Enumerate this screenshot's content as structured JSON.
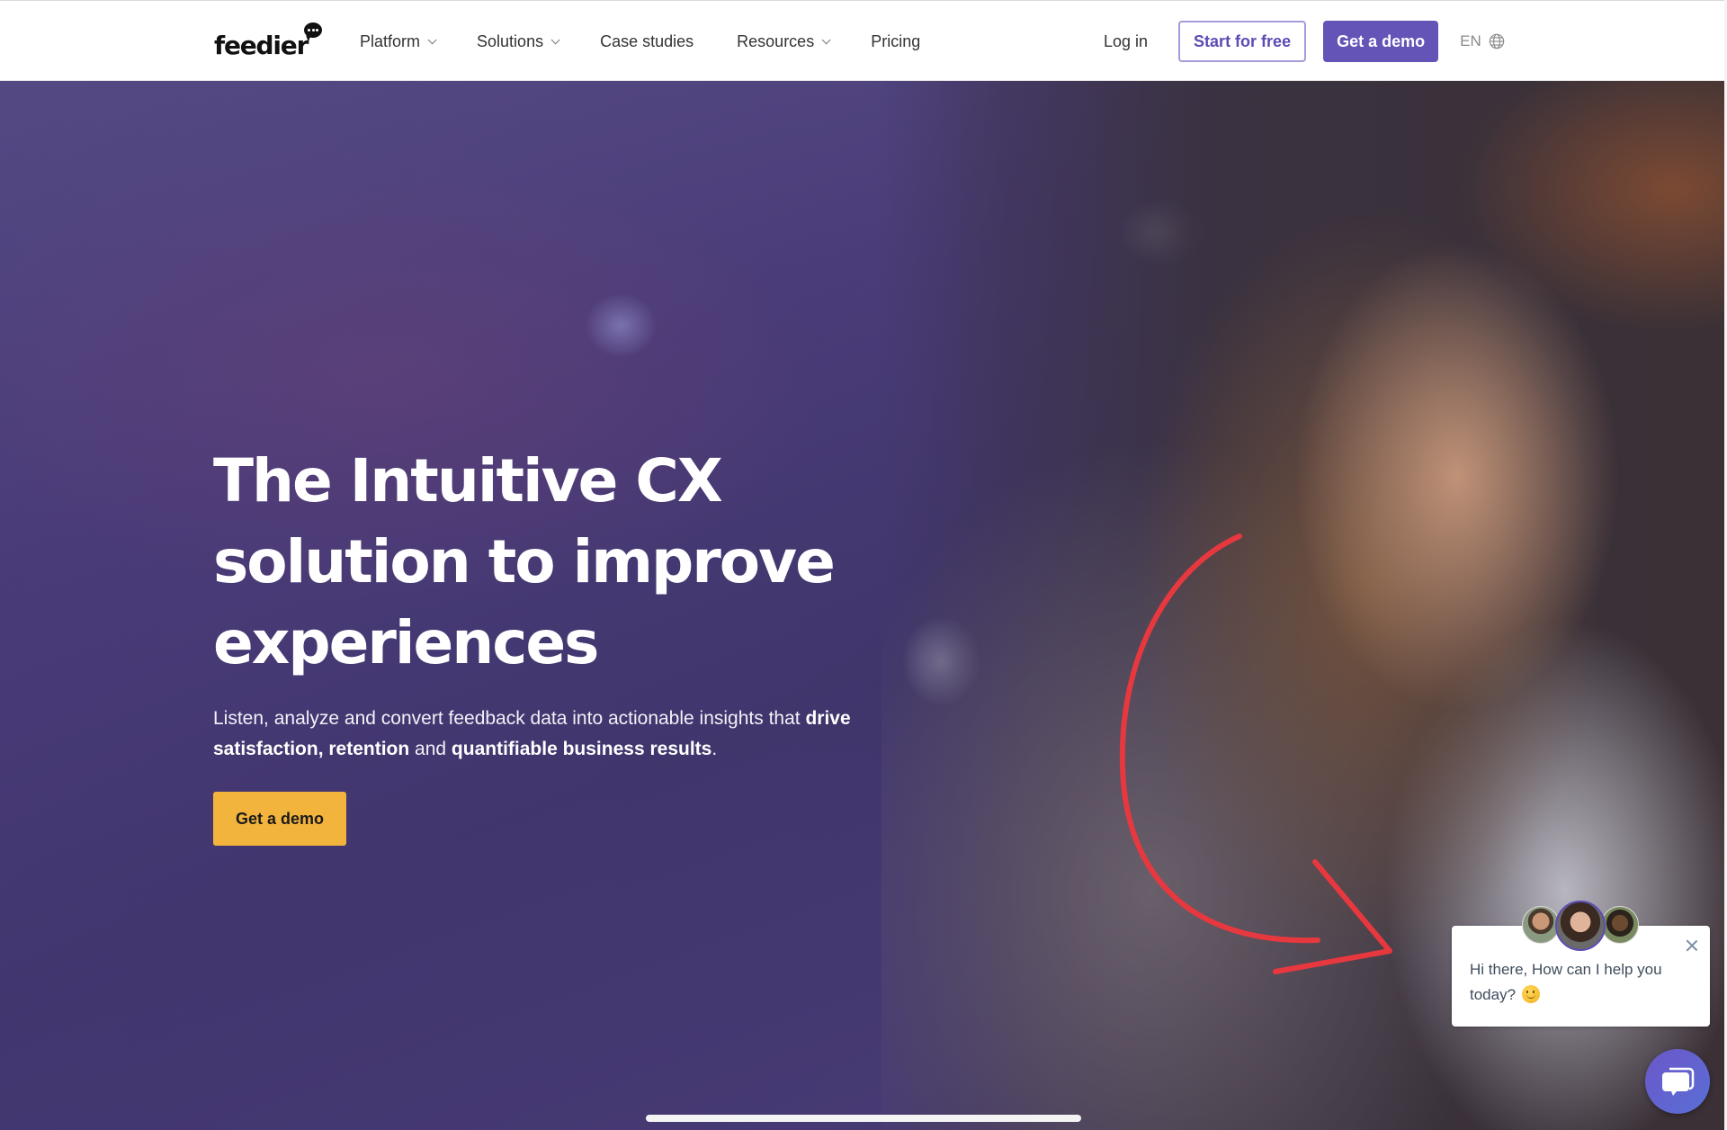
{
  "nav": {
    "logo": "feedier",
    "menu": [
      {
        "label": "Platform",
        "has_dropdown": true
      },
      {
        "label": "Solutions",
        "has_dropdown": true
      },
      {
        "label": "Case studies",
        "has_dropdown": false
      },
      {
        "label": "Resources",
        "has_dropdown": true
      },
      {
        "label": "Pricing",
        "has_dropdown": false
      }
    ],
    "login": "Log in",
    "start_free": "Start for free",
    "get_demo": "Get a demo",
    "language": "EN",
    "language_icon": "globe-icon"
  },
  "hero": {
    "title_lines": [
      "The Intuitive CX",
      "solution to improve",
      "experiences"
    ],
    "subtitle": {
      "part1": "Listen, analyze and convert feedback data into actionable insights that ",
      "bold1": "drive satisfaction, retention",
      "part2": " and ",
      "bold2": "quantifiable business results",
      "part3": "."
    },
    "cta": "Get a demo"
  },
  "chat": {
    "message": "Hi there, How can I help you today?",
    "emoji": "slightly-smiling-face",
    "agents": 3,
    "close_icon": "close-icon",
    "launcher_icon": "chat-bubbles-icon"
  },
  "colors": {
    "brand_purple": "#6554b8",
    "cta_yellow": "#f2b43c",
    "arrow_red": "#e8383f"
  }
}
